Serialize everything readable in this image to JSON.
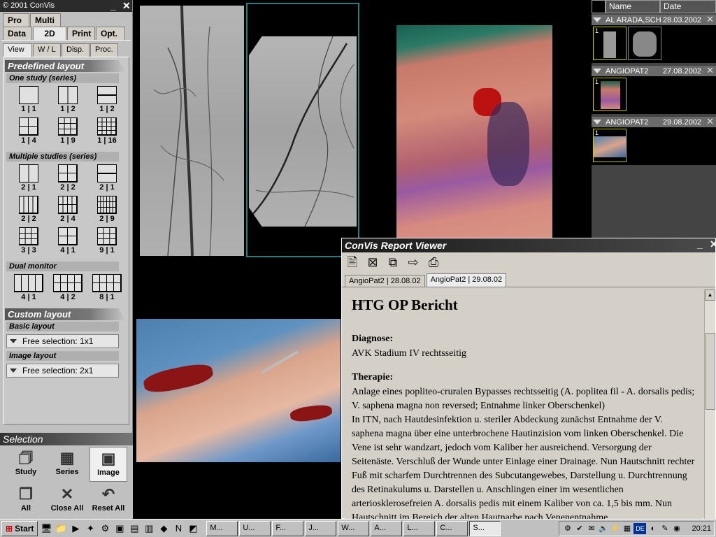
{
  "app": {
    "title": "© 2001 ConVis",
    "win_min": "_",
    "win_close": "✕"
  },
  "top_tabs": [
    {
      "label": "Pro"
    },
    {
      "label": "Multi"
    },
    {
      "label": "Data"
    },
    {
      "label": "2D"
    },
    {
      "label": "Print"
    },
    {
      "label": "Opt."
    }
  ],
  "sub_tabs": [
    {
      "label": "View"
    },
    {
      "label": "W / L"
    },
    {
      "label": "Disp."
    },
    {
      "label": "Proc."
    }
  ],
  "predefined": {
    "title": "Predefined layout",
    "one_study": {
      "title": "One study (series)",
      "items": [
        "1 | 1",
        "1 | 2",
        "1 | 2",
        "1 | 4",
        "1 | 9",
        "1 | 16"
      ]
    },
    "multiple": {
      "title": "Multiple studies (series)",
      "items": [
        "2 | 1",
        "2 | 2",
        "2 | 1",
        "2 | 2",
        "2 | 4",
        "2 | 9",
        "3 | 3",
        "4 | 1",
        "9 | 1"
      ]
    },
    "dual": {
      "title": "Dual monitor",
      "items": [
        "4 | 1",
        "4 | 2",
        "8 | 1"
      ]
    }
  },
  "custom": {
    "title": "Custom layout",
    "basic_title": "Basic layout",
    "basic_value": "Free selection: 1x1",
    "image_title": "Image layout",
    "image_value": "Free selection: 2x1"
  },
  "selection": {
    "title": "Selection",
    "buttons": [
      {
        "label": "Study"
      },
      {
        "label": "Series"
      },
      {
        "label": "Image"
      },
      {
        "label": "All"
      },
      {
        "label": "Close All"
      },
      {
        "label": "Reset All"
      }
    ]
  },
  "thumbs": {
    "col_name": "Name",
    "col_date": "Date",
    "studies": [
      {
        "name": "AL ARADA,SCH",
        "date": "28.03.2002",
        "numbers": [
          "1",
          ""
        ]
      },
      {
        "name": "ANGIOPAT2",
        "date": "27.08.2002",
        "numbers": [
          "1"
        ]
      },
      {
        "name": "ANGIOPAT2",
        "date": "29.08.2002",
        "numbers": [
          "1"
        ]
      }
    ]
  },
  "report": {
    "window_title": "ConVis Report Viewer",
    "tabs": [
      "AngioPat2 | 28.08.02",
      "AngioPat2 | 29.08.02"
    ],
    "heading": "HTG OP Bericht",
    "diagnose_label": "Diagnose:",
    "diagnose_text": "AVK Stadium IV rechtsseitig",
    "therapie_label": "Therapie:",
    "therapie_text_1": "Anlage eines popliteo-cruralen Bypasses rechtsseitig (A. poplitea fil - A. dorsalis pedis; V. saphena magna non reversed; Entnahme linker Oberschenkel)",
    "therapie_text_2": "In ITN, nach Hautdesinfektion u. steriler Abdeckung zunächst Entnahme der V. saphena magna über eine unterbrochene Hautinzision vom linken Oberschenkel. Die Vene ist sehr wandzart, jedoch vom Kaliber her ausreichend. Versorgung der Seitenäste. Verschluß der Wunde unter Einlage einer Drainage. Nun Hautschnitt rechter Fuß mit scharfem Durchtrennen des Subcutangewebes, Darstellung u. Durchtrennung des Retinakulums u. Darstellen u. Anschlingen einer im wesentlichen arteriosklerosefreien A. dorsalis pedis mit einem Kaliber von ca. 1,5 bis mm. Nun Hautschnitt im Bereich der alten Hautnarbe nach Venenentnahme"
  },
  "taskbar": {
    "start": "Start",
    "windows": [
      "M...",
      "U...",
      "F...",
      "J...",
      "W...",
      "A...",
      "L...",
      "C...",
      "S..."
    ],
    "lang": "DE",
    "clock": "20:21"
  },
  "colors": {
    "panel_bg": "#c0c0c0",
    "thumb_border": "#c8c800",
    "viewer_bg": "#000000",
    "active_pane_border": "#2e7d7d"
  }
}
